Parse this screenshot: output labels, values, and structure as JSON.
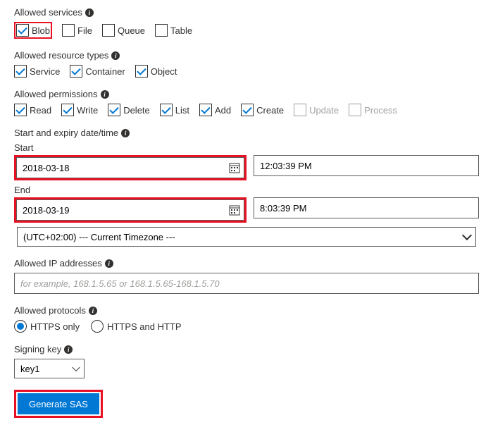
{
  "services": {
    "title": "Allowed services",
    "items": [
      {
        "label": "Blob",
        "checked": true,
        "highlight": true
      },
      {
        "label": "File",
        "checked": false
      },
      {
        "label": "Queue",
        "checked": false
      },
      {
        "label": "Table",
        "checked": false
      }
    ]
  },
  "resourceTypes": {
    "title": "Allowed resource types",
    "items": [
      {
        "label": "Service",
        "checked": true
      },
      {
        "label": "Container",
        "checked": true
      },
      {
        "label": "Object",
        "checked": true
      }
    ]
  },
  "permissions": {
    "title": "Allowed permissions",
    "items": [
      {
        "label": "Read",
        "checked": true
      },
      {
        "label": "Write",
        "checked": true
      },
      {
        "label": "Delete",
        "checked": true
      },
      {
        "label": "List",
        "checked": true
      },
      {
        "label": "Add",
        "checked": true
      },
      {
        "label": "Create",
        "checked": true
      },
      {
        "label": "Update",
        "checked": false,
        "disabled": true
      },
      {
        "label": "Process",
        "checked": false,
        "disabled": true
      }
    ]
  },
  "datetime": {
    "title": "Start and expiry date/time",
    "startLabel": "Start",
    "startDate": "2018-03-18",
    "startTime": "12:03:39 PM",
    "endLabel": "End",
    "endDate": "2018-03-19",
    "endTime": "8:03:39 PM",
    "timezone": "(UTC+02:00) --- Current Timezone ---"
  },
  "ip": {
    "title": "Allowed IP addresses",
    "placeholder": "for example, 168.1.5.65 or 168.1.5.65-168.1.5.70"
  },
  "protocols": {
    "title": "Allowed protocols",
    "options": [
      {
        "label": "HTTPS only",
        "selected": true
      },
      {
        "label": "HTTPS and HTTP",
        "selected": false
      }
    ]
  },
  "signingKey": {
    "title": "Signing key",
    "value": "key1"
  },
  "generate": {
    "label": "Generate SAS"
  }
}
